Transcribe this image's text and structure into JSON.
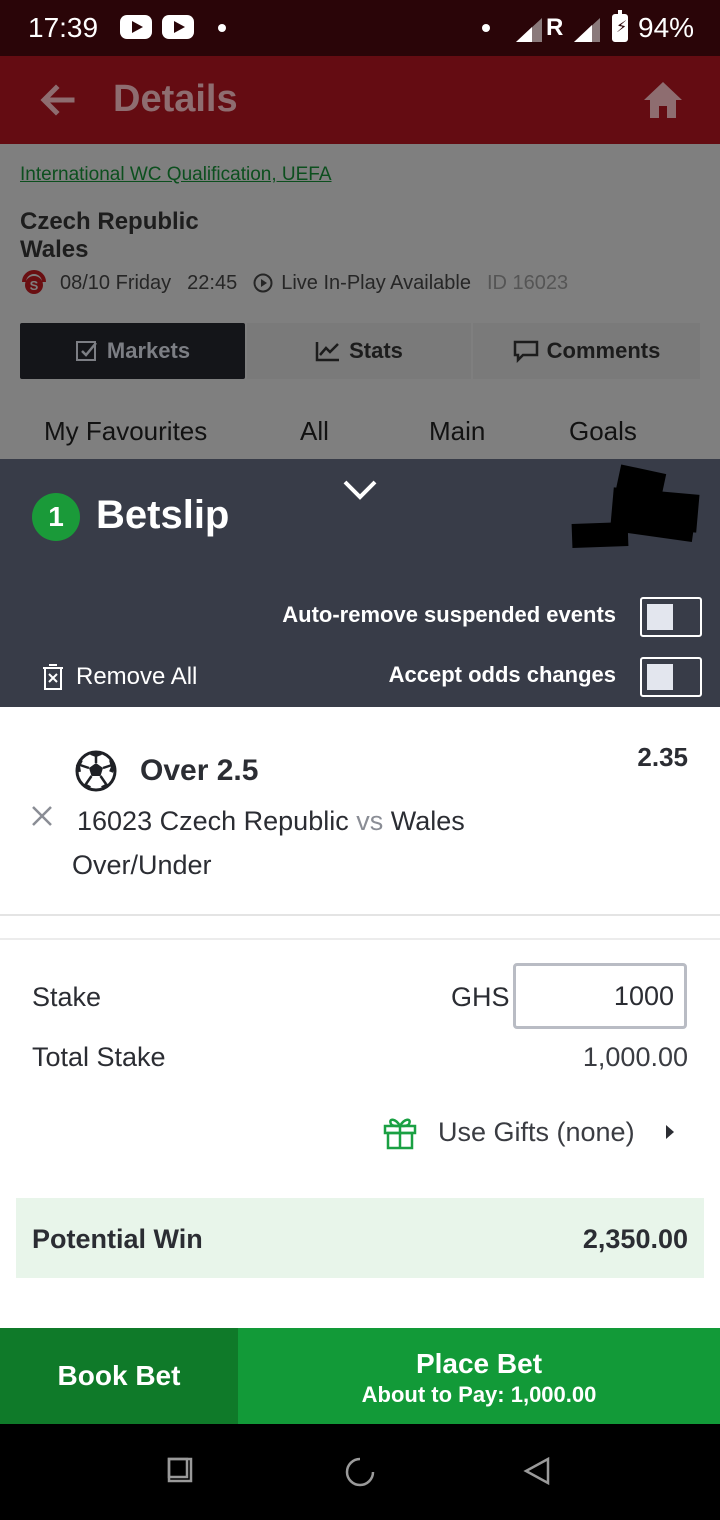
{
  "status_bar": {
    "time": "17:39",
    "network_label": "R",
    "battery": "94%"
  },
  "app_bar": {
    "title": "Details"
  },
  "match": {
    "league": "International WC Qualification, UEFA",
    "home_team": "Czech Republic",
    "away_team": "Wales",
    "date": "08/10 Friday",
    "time": "22:45",
    "live_label": "Live In-Play Available",
    "id_label": "ID 16023"
  },
  "tabs": {
    "markets": "Markets",
    "stats": "Stats",
    "comments": "Comments"
  },
  "subtabs": [
    "My Favourites",
    "All",
    "Main",
    "Goals"
  ],
  "betslip": {
    "count": "1",
    "title": "Betslip",
    "auto_remove_label": "Auto-remove suspended events",
    "accept_odds_label": "Accept odds changes",
    "remove_all_label": "Remove All",
    "auto_remove_enabled": false,
    "accept_odds_enabled": false
  },
  "selection": {
    "name": "Over 2.5",
    "odds": "2.35",
    "event_id": "16023",
    "home": "Czech Republic",
    "vs": "vs",
    "away": "Wales",
    "market": "Over/Under"
  },
  "stake": {
    "label": "Stake",
    "currency": "GHS",
    "value": "1000",
    "total_label": "Total Stake",
    "total_value": "1,000.00"
  },
  "gifts": {
    "label": "Use Gifts (none)"
  },
  "potential": {
    "label": "Potential Win",
    "value": "2,350.00"
  },
  "buttons": {
    "book_bet": "Book Bet",
    "place_bet": "Place Bet",
    "about_to_pay": "About to Pay: 1,000.00"
  },
  "colors": {
    "accent_green": "#129a38",
    "header_red": "#640c12",
    "betslip_bg": "#383c48",
    "potential_bg": "#e8f5ea"
  }
}
